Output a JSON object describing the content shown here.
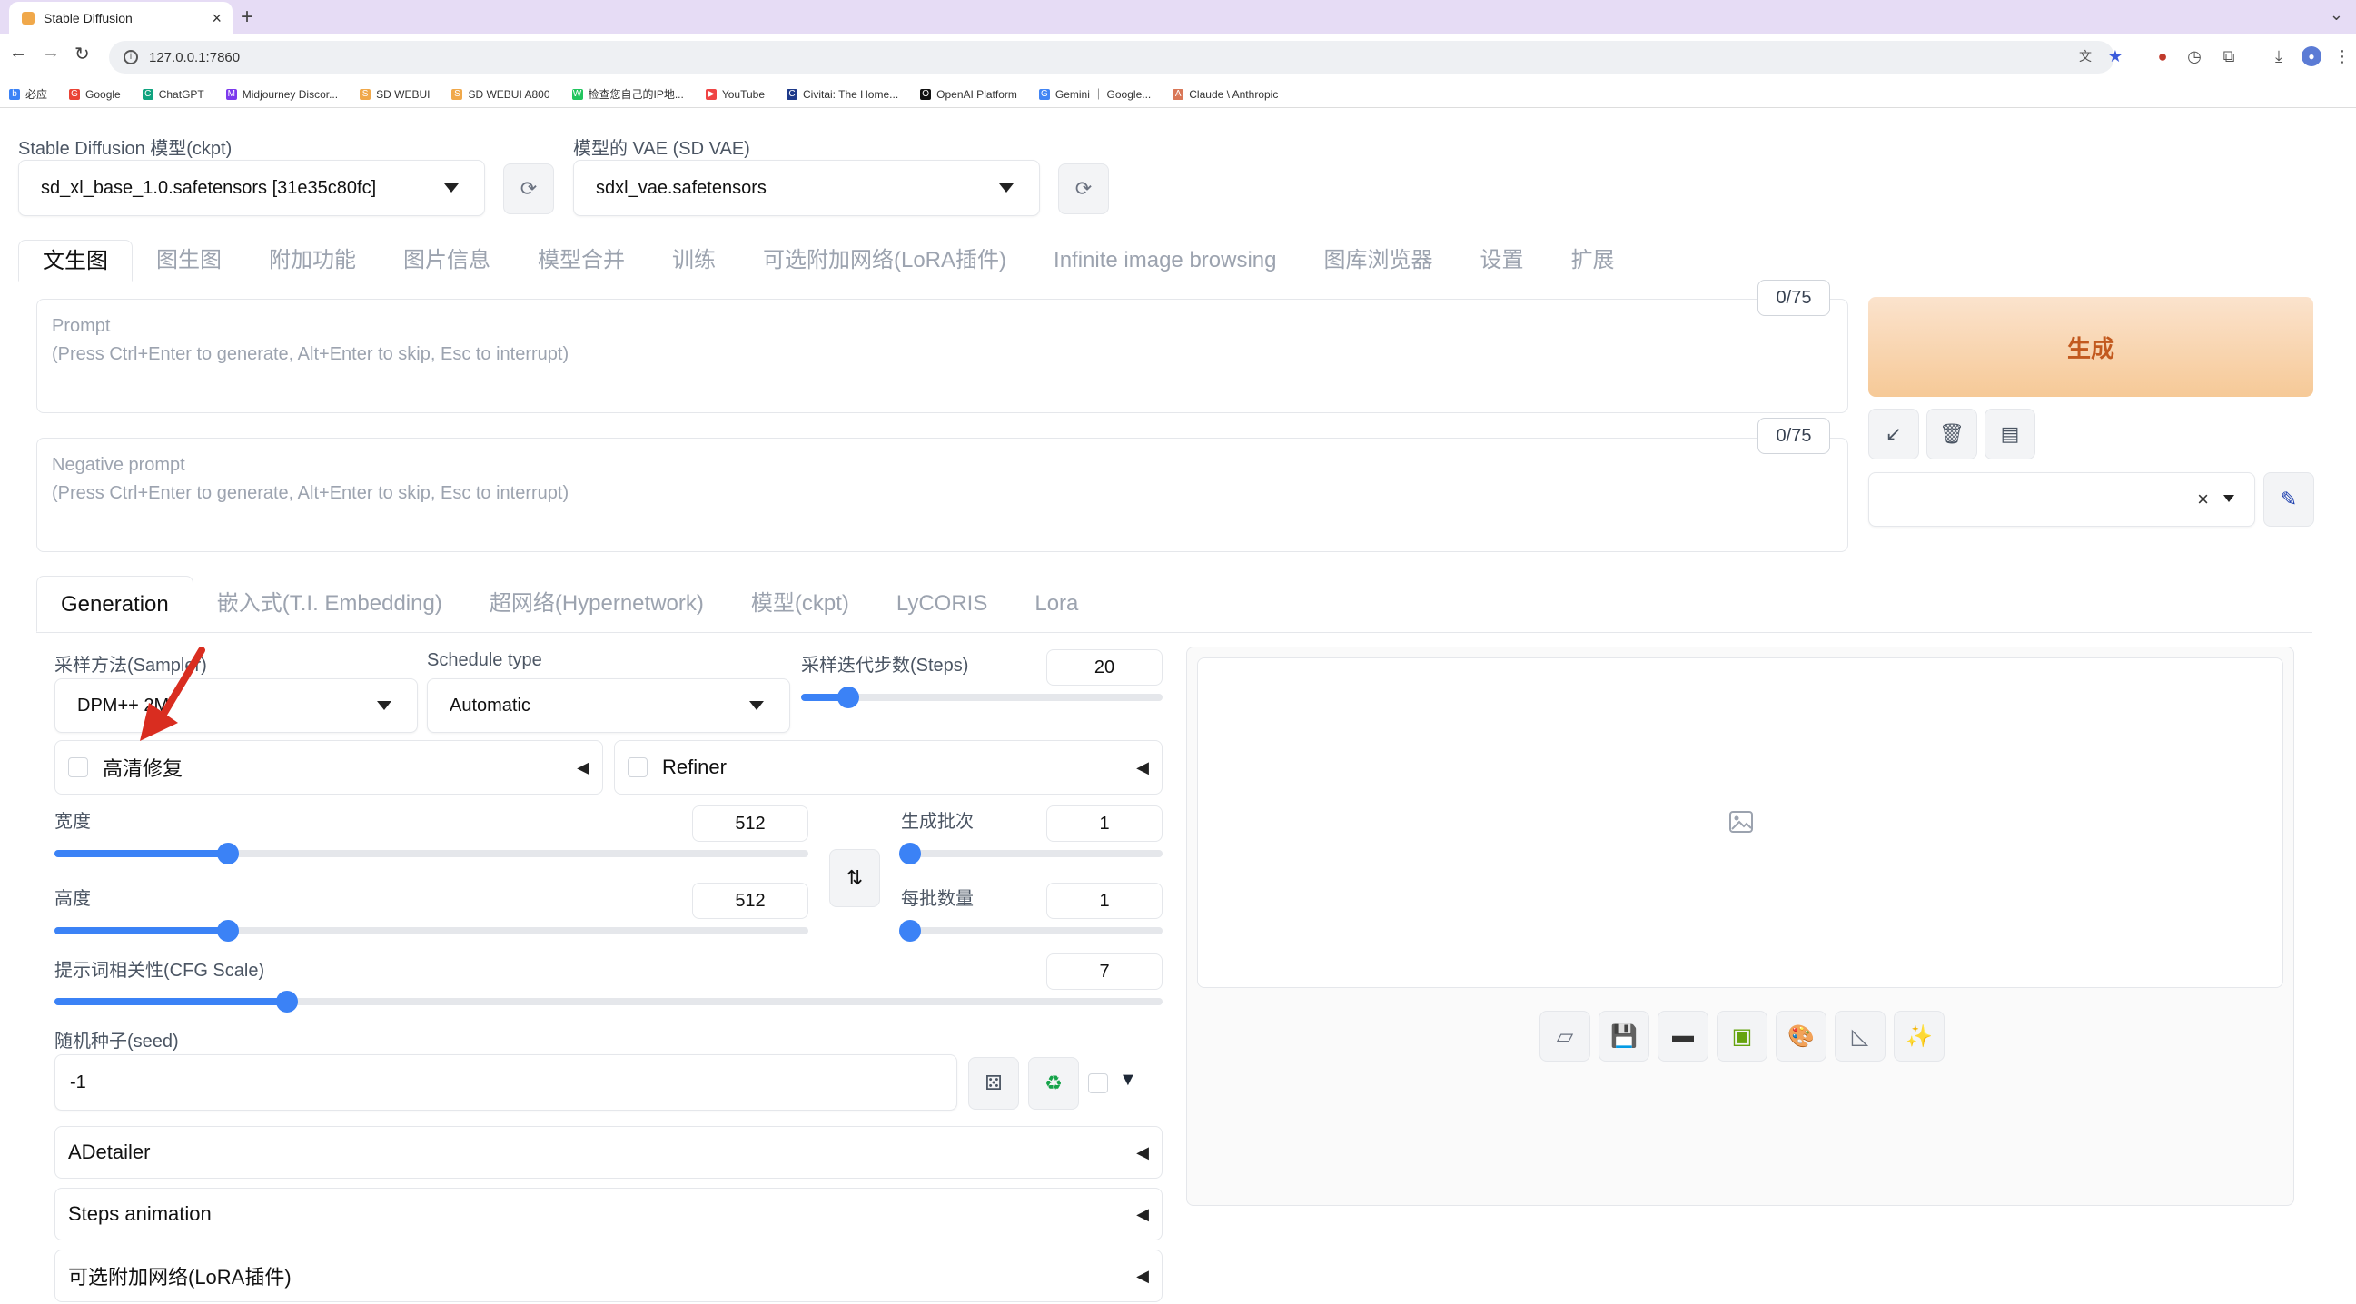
{
  "browser": {
    "tab_title": "Stable Diffusion",
    "url": "127.0.0.1:7860",
    "bookmarks": [
      "必应",
      "Google",
      "ChatGPT",
      "Midjourney Discor...",
      "SD WEBUI",
      "SD WEBUI A800",
      "检查您自己的IP地...",
      "YouTube",
      "Civitai: The Home...",
      "OpenAI Platform",
      "Gemini ｜ Google...",
      "Claude \\ Anthropic"
    ]
  },
  "model": {
    "ckpt_label": "Stable Diffusion 模型(ckpt)",
    "ckpt_value": "sd_xl_base_1.0.safetensors [31e35c80fc]",
    "vae_label": "模型的 VAE (SD VAE)",
    "vae_value": "sdxl_vae.safetensors"
  },
  "main_tabs": [
    "文生图",
    "图生图",
    "附加功能",
    "图片信息",
    "模型合并",
    "训练",
    "可选附加网络(LoRA插件)",
    "Infinite image browsing",
    "图库浏览器",
    "设置",
    "扩展"
  ],
  "prompt": {
    "title": "Prompt",
    "hint": "(Press Ctrl+Enter to generate, Alt+Enter to skip, Esc to interrupt)",
    "counter": "0/75"
  },
  "negative_prompt": {
    "title": "Negative prompt",
    "hint": "(Press Ctrl+Enter to generate, Alt+Enter to skip, Esc to interrupt)",
    "counter": "0/75"
  },
  "generate_label": "生成",
  "sub_tabs": [
    "Generation",
    "嵌入式(T.I. Embedding)",
    "超网络(Hypernetwork)",
    "模型(ckpt)",
    "LyCORIS",
    "Lora"
  ],
  "sampler": {
    "label": "采样方法(Sampler)",
    "value": "DPM++ 2M"
  },
  "schedule": {
    "label": "Schedule type",
    "value": "Automatic"
  },
  "steps": {
    "label": "采样迭代步数(Steps)",
    "value": "20",
    "fraction": 0.13
  },
  "hires_label": "高清修复",
  "refiner_label": "Refiner",
  "width": {
    "label": "宽度",
    "value": "512",
    "fraction": 0.23
  },
  "height": {
    "label": "高度",
    "value": "512",
    "fraction": 0.23
  },
  "batch_count": {
    "label": "生成批次",
    "value": "1",
    "fraction": 0.0
  },
  "batch_size": {
    "label": "每批数量",
    "value": "1",
    "fraction": 0.0
  },
  "cfg": {
    "label": "提示词相关性(CFG Scale)",
    "value": "7",
    "fraction": 0.21
  },
  "seed": {
    "label": "随机种子(seed)",
    "value": "-1"
  },
  "accordions": [
    "ADetailer",
    "Steps animation",
    "可选附加网络(LoRA插件)"
  ]
}
